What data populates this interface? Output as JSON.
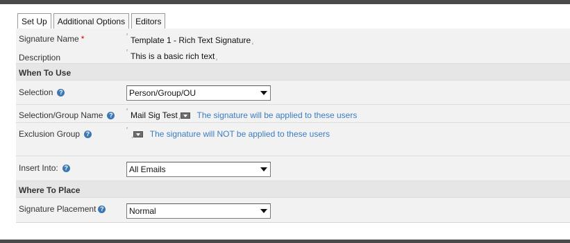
{
  "tabs": [
    {
      "label": "Set Up",
      "active": true
    },
    {
      "label": "Additional Options",
      "active": false
    },
    {
      "label": "Editors",
      "active": false
    }
  ],
  "fields": {
    "signature_name": {
      "label": "Signature Name",
      "required_mark": "*",
      "value": "Template 1 - Rich Text Signature"
    },
    "description": {
      "label": "Description",
      "value": "This is a basic rich text"
    }
  },
  "sections": {
    "when_to_use": "When To Use",
    "where_to_place": "Where To Place"
  },
  "selection": {
    "label": "Selection",
    "value": "Person/Group/OU"
  },
  "selection_group_name": {
    "label": "Selection/Group Name",
    "value": "Mail Sig Test",
    "hint": "The signature will be applied to these users"
  },
  "exclusion_group": {
    "label": "Exclusion Group",
    "value": "",
    "hint": "The signature will NOT be applied to these users"
  },
  "insert_into": {
    "label": "Insert Into:",
    "value": "All Emails"
  },
  "signature_placement": {
    "label": "Signature Placement",
    "value": "Normal"
  },
  "icons": {
    "help": "help-icon",
    "corner_open": "⸢",
    "corner_close": "⸥"
  },
  "colors": {
    "hint_blue": "#3a7cc2",
    "required_red": "#d40000",
    "help_blue": "#3b78b4"
  }
}
